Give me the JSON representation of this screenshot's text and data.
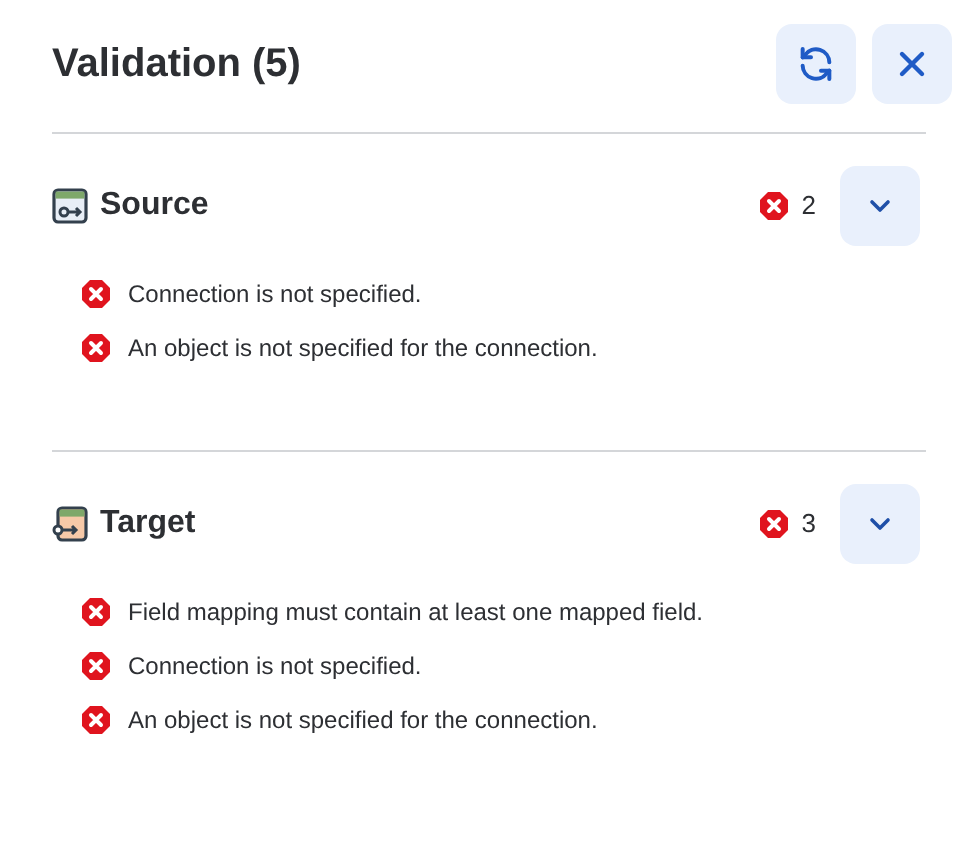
{
  "title": "Validation (5)",
  "sections": [
    {
      "kind": "source",
      "name": "Source",
      "count": "2",
      "expanded": true,
      "errors": [
        "Connection is not specified.",
        "An object is not specified for the connection."
      ]
    },
    {
      "kind": "target",
      "name": "Target",
      "count": "3",
      "expanded": true,
      "errors": [
        "Field mapping must contain at least one mapped field.",
        "Connection is not specified.",
        "An object is not specified for the connection."
      ]
    }
  ]
}
